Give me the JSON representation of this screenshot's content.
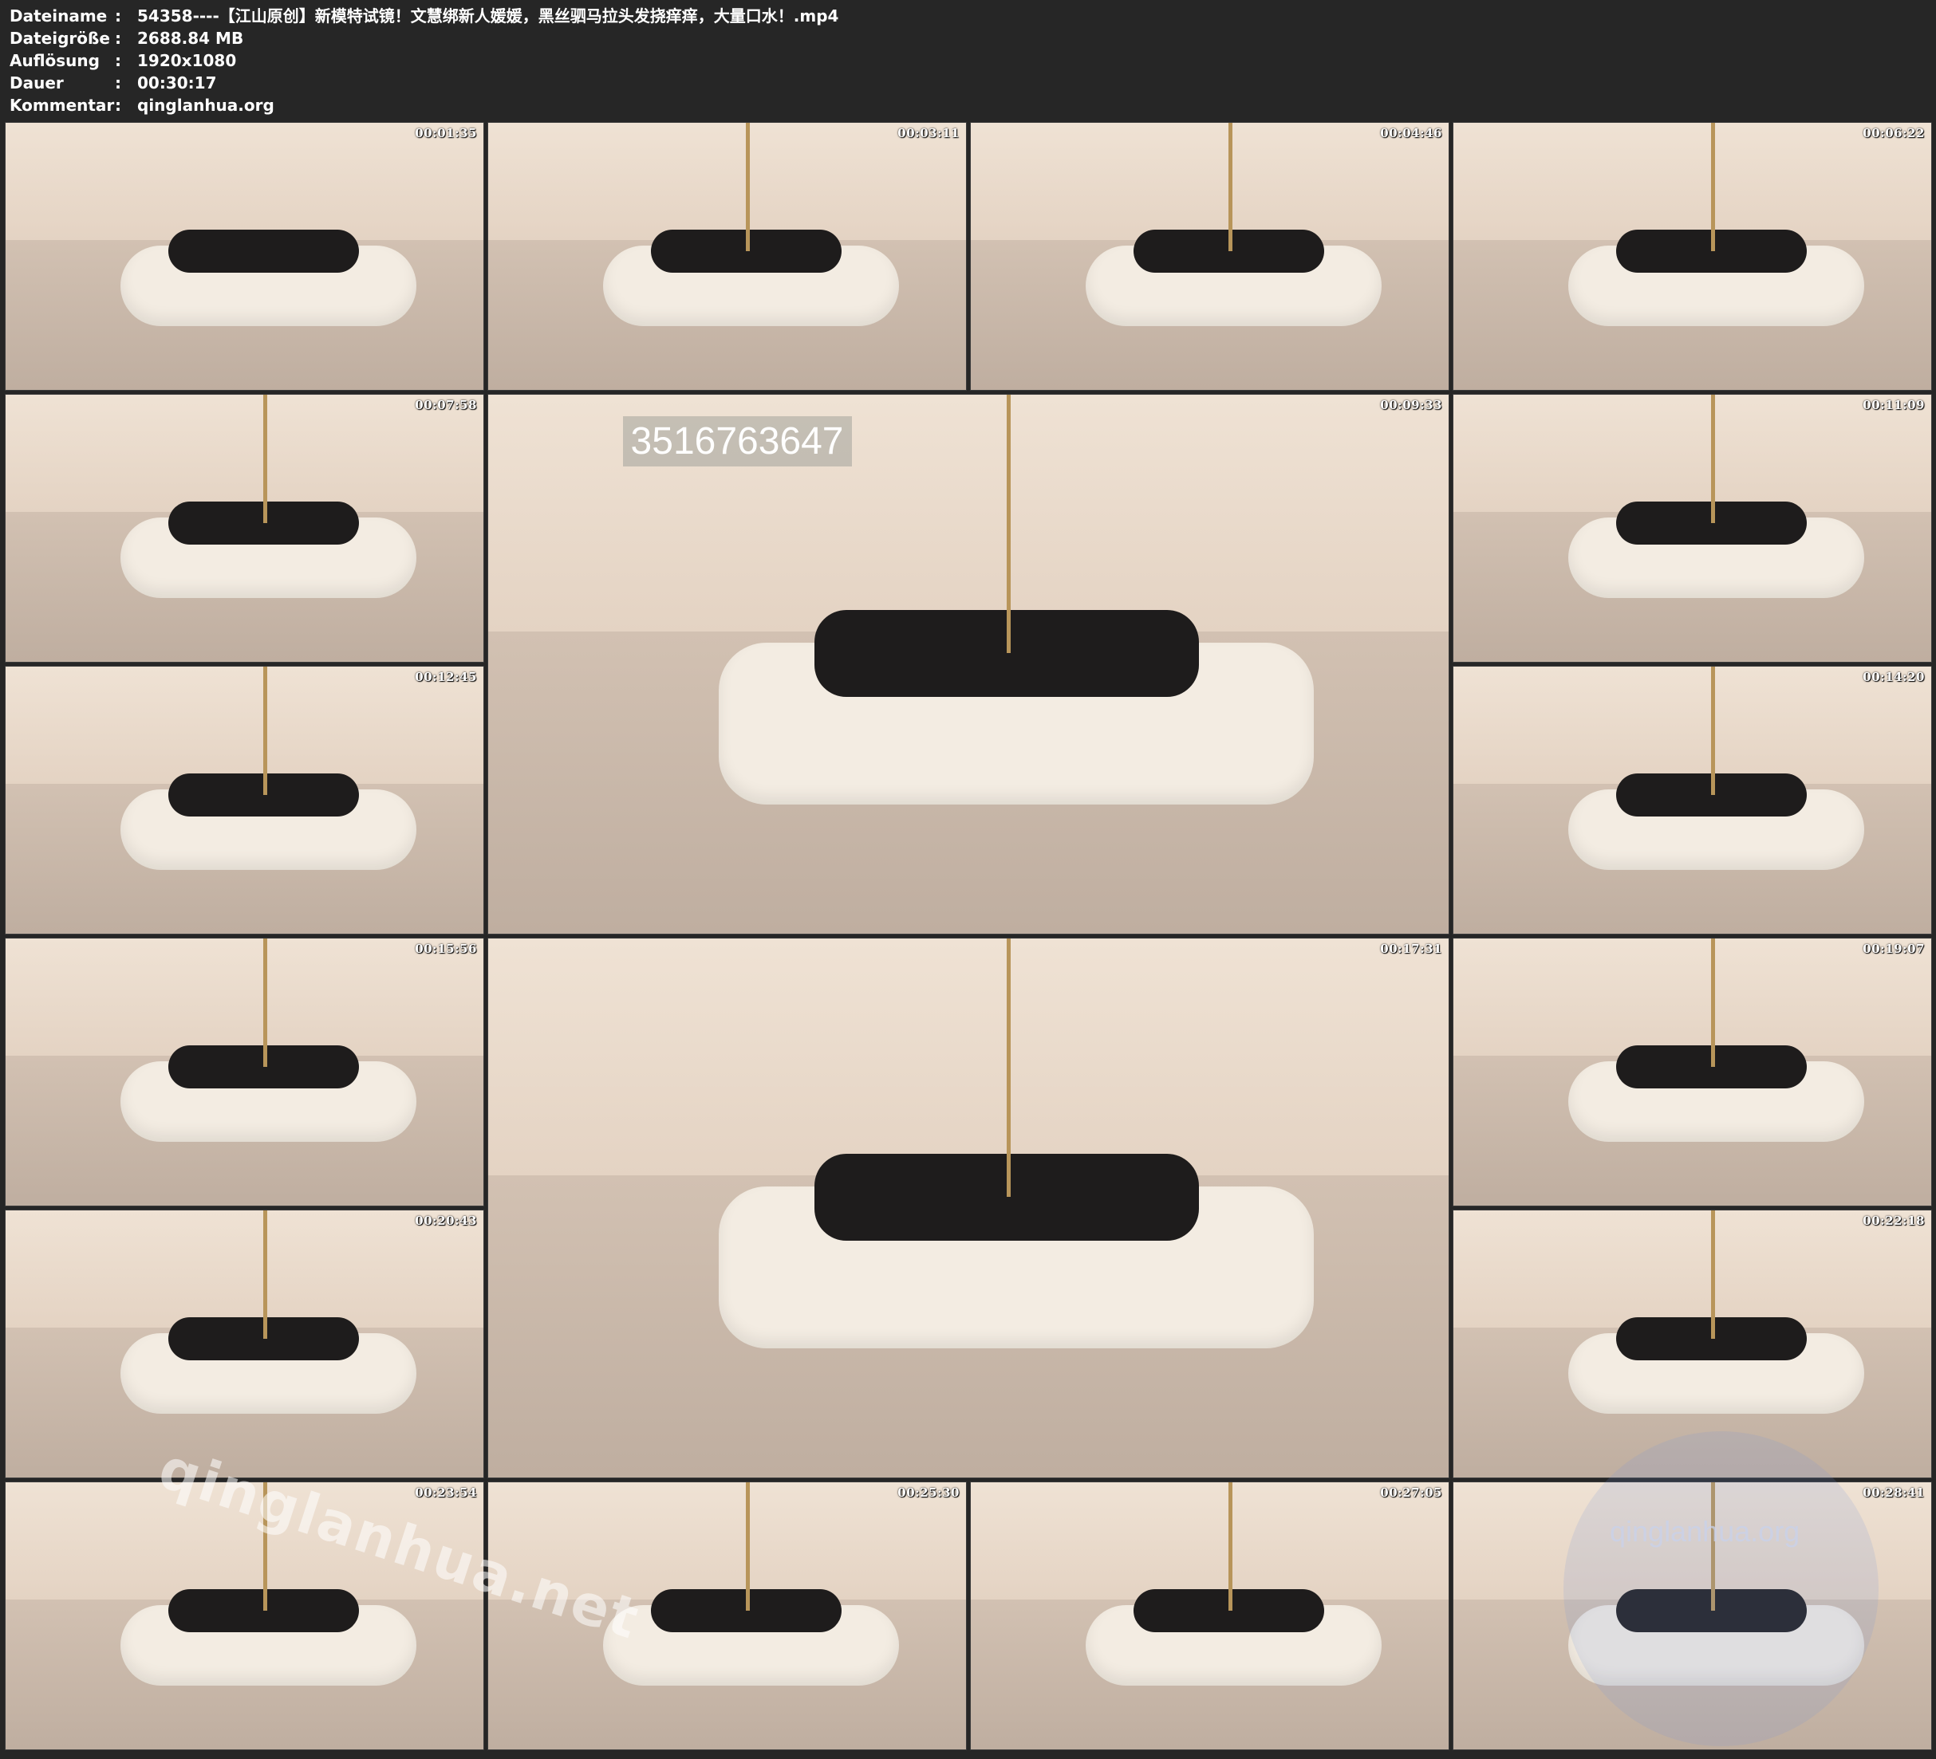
{
  "info": {
    "rows": [
      {
        "key": "Dateiname",
        "sep": ":",
        "value": "54358----【江山原创】新模特试镜！文慧绑新人媛媛，黑丝驷马拉头发挠痒痒，大量口水！.mp4"
      },
      {
        "key": "Dateigröße",
        "sep": ":",
        "value": "2688.84 MB"
      },
      {
        "key": "Auflösung",
        "sep": ":",
        "value": "1920x1080"
      },
      {
        "key": "Dauer",
        "sep": ":",
        "value": "00:30:17"
      },
      {
        "key": "Kommentar",
        "sep": ":",
        "value": "qinglanhua.org"
      }
    ]
  },
  "thumbnails": [
    {
      "timestamp": "00:01:35"
    },
    {
      "timestamp": "00:03:11"
    },
    {
      "timestamp": "00:04:46"
    },
    {
      "timestamp": "00:06:22"
    },
    {
      "timestamp": "00:07:58"
    },
    {
      "timestamp": "00:09:33",
      "overlay_text": "3516763647"
    },
    {
      "timestamp": "00:11:09"
    },
    {
      "timestamp": "00:12:45"
    },
    {
      "timestamp": "00:14:20"
    },
    {
      "timestamp": "00:15:56"
    },
    {
      "timestamp": "00:17:31"
    },
    {
      "timestamp": "00:19:07"
    },
    {
      "timestamp": "00:20:43"
    },
    {
      "timestamp": "00:22:18"
    },
    {
      "timestamp": "00:23:54"
    },
    {
      "timestamp": "00:25:30"
    },
    {
      "timestamp": "00:27:05"
    },
    {
      "timestamp": "00:28:41"
    }
  ],
  "watermarks": {
    "left": "qinglanhua.net",
    "right": "qinglanhua.org"
  },
  "colors": {
    "background": "#262626",
    "text": "#ffffff",
    "rope": "#b8955a"
  }
}
